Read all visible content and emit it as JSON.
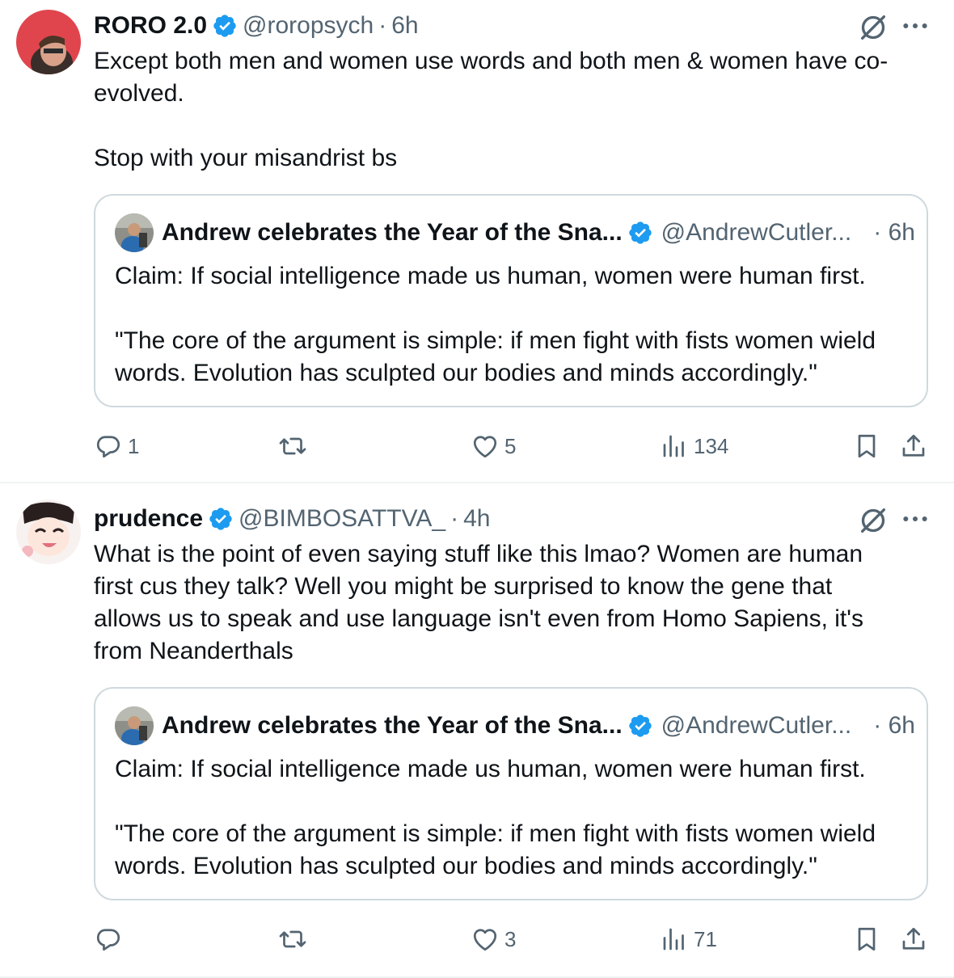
{
  "tweets": [
    {
      "author_name": "RORO 2.0",
      "handle": "@roropsych",
      "separator": "·",
      "time": "6h",
      "text": "Except both men and women use words and both men & women have co-\nevolved.\n\nStop with your misandrist bs",
      "quote": {
        "author_name": "Andrew celebrates the Year of the Sna...",
        "handle": "@AndrewCutler...",
        "time": "· 6h",
        "text": "Claim: If social intelligence made us human, women were human first.\n\n\"The core of the argument is simple: if men fight with fists women wield\nwords. Evolution has sculpted our bodies and minds accordingly.\""
      },
      "stats": {
        "replies": "1",
        "reposts": "",
        "likes": "5",
        "views": "134"
      }
    },
    {
      "author_name": "prudence",
      "handle": "@BIMBOSATTVA_",
      "separator": "·",
      "time": "4h",
      "text": "What is the point of even saying stuff like this lmao? Women are human\nfirst cus they talk? Well you might be surprised to know the gene that\nallows us to speak and use language isn't even from Homo Sapiens, it's\nfrom Neanderthals",
      "quote": {
        "author_name": "Andrew celebrates the Year of the Sna...",
        "handle": "@AndrewCutler...",
        "time": "· 6h",
        "text": "Claim: If social intelligence made us human, women were human first.\n\n\"The core of the argument is simple: if men fight with fists women wield\nwords. Evolution has sculpted our bodies and minds accordingly.\""
      },
      "stats": {
        "replies": "",
        "reposts": "",
        "likes": "3",
        "views": "71"
      }
    }
  ],
  "icons": {
    "verified_badge": "verified-badge-icon",
    "grok": "grok-icon",
    "more": "more-icon",
    "reply": "reply-icon",
    "repost": "repost-icon",
    "like": "heart-icon",
    "views": "views-icon",
    "bookmark": "bookmark-icon",
    "share": "share-icon"
  },
  "colors": {
    "verified": "#1d9bf0",
    "secondary_text": "#536471",
    "border": "#cfd9de"
  }
}
